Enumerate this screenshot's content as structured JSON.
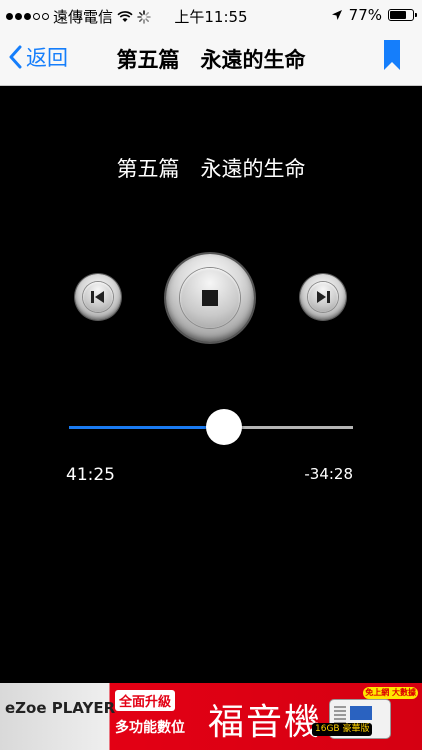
{
  "status_bar": {
    "carrier": "遠傳電信",
    "time": "上午11:55",
    "battery_percent": "77%",
    "battery_level": 0.77,
    "signal_strength_dots": 3,
    "icons": [
      "signal-dots-icon",
      "wifi-icon",
      "activity-spinner-icon",
      "location-arrow-icon",
      "battery-icon"
    ]
  },
  "nav": {
    "back_label": "返回",
    "title": "第五篇　永遠的生命",
    "back_icon": "chevron-left-icon",
    "bookmark_icon": "bookmark-icon"
  },
  "player": {
    "track_title": "第五篇　永遠的生命",
    "elapsed": "41:25",
    "remaining": "-34:28",
    "progress": 0.5463,
    "controls": [
      "previous-track-icon",
      "stop-icon",
      "next-track-icon"
    ]
  },
  "ad": {
    "brand": "eZoe PLAYER",
    "badge": "全面升級",
    "subtitle": "多功能數位",
    "headline": "福音機",
    "capacity": "16GB 豪華版",
    "corner": "免上網 大數據"
  },
  "colors": {
    "accent": "#157efb",
    "slider_played": "#1a7bf2",
    "slider_remaining": "#b5b5b5",
    "background": "#000000",
    "ad_red": "#e30014"
  }
}
